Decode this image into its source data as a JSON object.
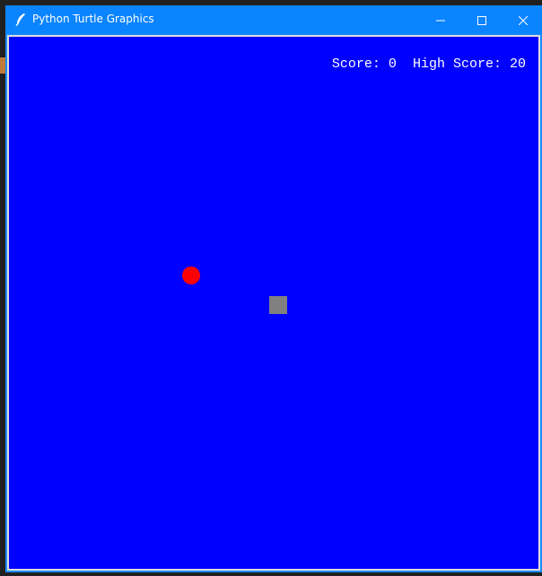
{
  "window": {
    "title": "Python Turtle Graphics",
    "titlebar_color": "#0a84ff",
    "icons": {
      "app": "feather-icon",
      "minimize": "minimize-icon",
      "maximize": "maximize-icon",
      "close": "close-icon"
    }
  },
  "game": {
    "background_color": "#0000ff",
    "score_label": "Score:",
    "score": "0",
    "high_score_label": "High Score:",
    "high_score": "20",
    "food_color": "#ff0000",
    "snake_head_color": "#808080"
  }
}
